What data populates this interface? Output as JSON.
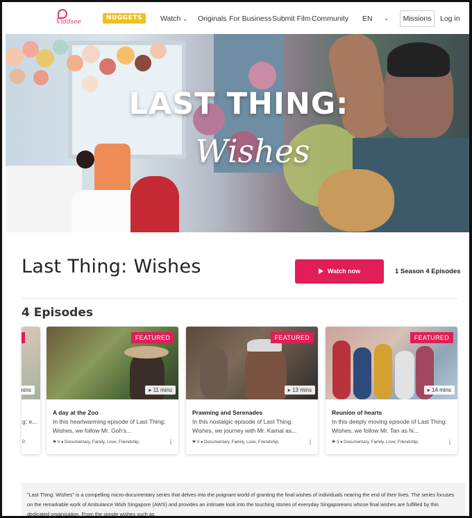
{
  "nav": {
    "logo_text": "Viddsee",
    "nuggets_label": "NUGGETS",
    "links": [
      "Watch",
      "Originals",
      "For Business",
      "Submit Film",
      "Community"
    ],
    "language": "EN",
    "missions": "Missions",
    "login": "Log in"
  },
  "hero": {
    "title_line1": "LAST THING:",
    "title_line2": "Wishes"
  },
  "show": {
    "title": "Last Thing: Wishes",
    "watch_button": "Watch now",
    "season_info": "1 Season 4 Episodes"
  },
  "episodes": {
    "heading": "4 Episodes",
    "partial": {
      "badge": "ED",
      "duration": "mins",
      "desc": "g: e...",
      "meta": "P."
    },
    "items": [
      {
        "badge": "FEATURED",
        "duration": "11 mins",
        "title": "A day at the Zoo",
        "desc": "In this heartwarming episode of Last Thing: Wishes, we follow Mr. Goh's...",
        "likes": "0",
        "tags": "Documentary, Family, Love, Friendship,"
      },
      {
        "badge": "FEATURED",
        "duration": "13 mins",
        "title": "Prawning and Serenades",
        "desc": "In this nostalgic episode of Last Thing: Wishes, we journey with Mr. Kamal as...",
        "likes": "0",
        "tags": "Documentary, Family, Love, Friendship,"
      },
      {
        "badge": "FEATURED",
        "duration": "14 mins",
        "title": "Reunion of hearts",
        "desc": "In this deeply moving episode of Last Thing: Wishes, we follow Mr. Tan as hi...",
        "likes": "3",
        "tags": "Documentary, Family, Love, Friendship,"
      }
    ]
  },
  "about": {
    "text": "\"Last Thing: Wishes\" is a compelling micro-documentary series that delves into the poignant world of granting the final wishes of individuals nearing the end of their lives. The series focuses on the remarkable work of Ambulance Wish Singapore (AWS) and provides an intimate look into the touching stories of everyday Singaporeans whose final wishes are fulfilled by this dedicated organisation. From the simple wishes such as"
  },
  "colors": {
    "brand": "#e01e57",
    "nuggets": "#f0c020"
  }
}
